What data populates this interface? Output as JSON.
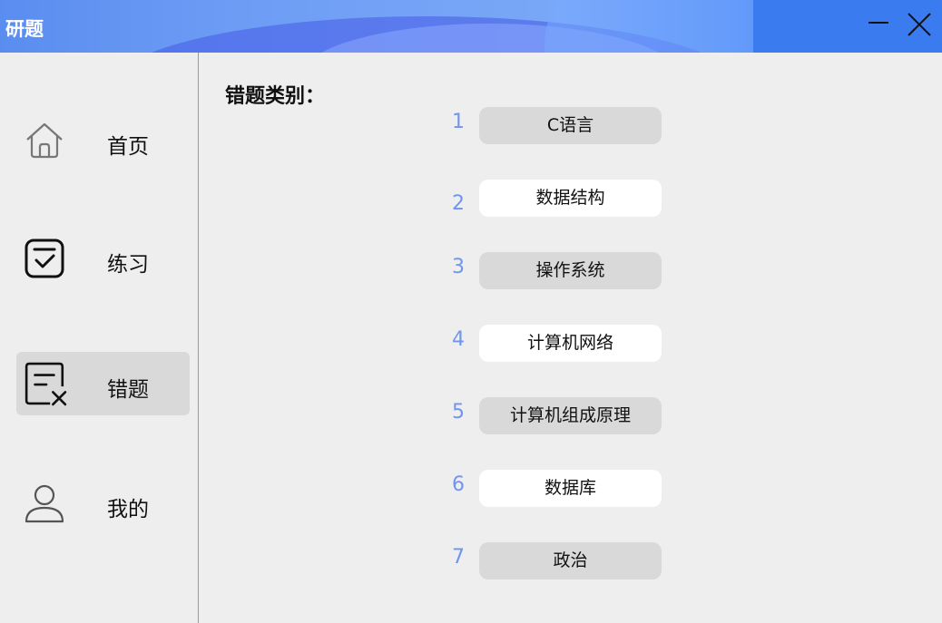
{
  "app": {
    "title": "研题"
  },
  "window": {
    "minimize_icon": "minimize-icon",
    "close_icon": "close-icon"
  },
  "sidebar": {
    "items": [
      {
        "label": "首页",
        "icon": "home-icon",
        "active": false
      },
      {
        "label": "练习",
        "icon": "checkbox-icon",
        "active": false
      },
      {
        "label": "错题",
        "icon": "wrong-question-icon",
        "active": true
      },
      {
        "label": "我的",
        "icon": "user-icon",
        "active": false
      }
    ]
  },
  "main": {
    "section_title": "错题类别：",
    "categories": [
      {
        "num": "1",
        "label": "C语言"
      },
      {
        "num": "2",
        "label": "数据结构"
      },
      {
        "num": "3",
        "label": "操作系统"
      },
      {
        "num": "4",
        "label": "计算机网络"
      },
      {
        "num": "5",
        "label": "计算机组成原理"
      },
      {
        "num": "6",
        "label": "数据库"
      },
      {
        "num": "7",
        "label": "政治"
      }
    ]
  },
  "colors": {
    "accent": "#6f95ef",
    "titlebar": "#3d7ff2",
    "active_bg": "#d9d9d9"
  }
}
